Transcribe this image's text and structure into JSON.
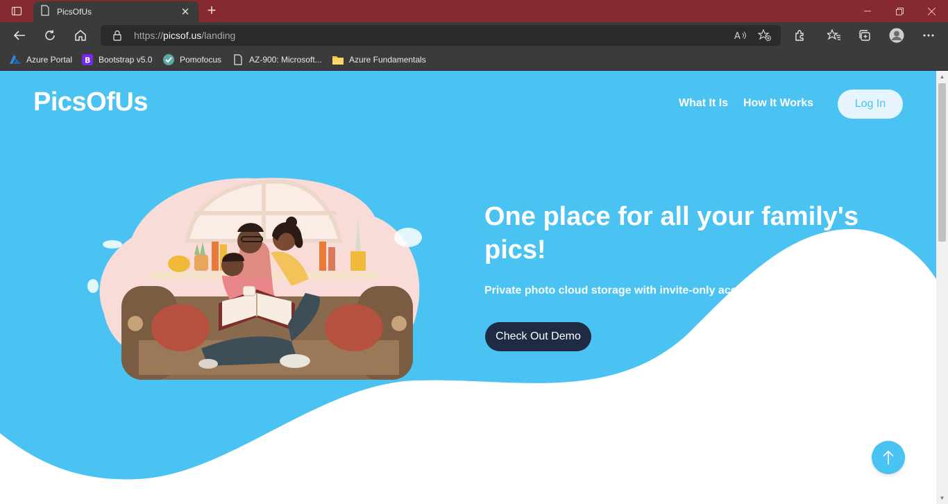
{
  "browser": {
    "tab_title": "PicsOfUs",
    "url_prefix": "https://",
    "url_host": "picsof.us",
    "url_path": "/landing",
    "bookmarks": [
      {
        "label": "Azure Portal",
        "icon": "azure-icon"
      },
      {
        "label": "Bootstrap v5.0",
        "icon": "bootstrap-icon"
      },
      {
        "label": "Pomofocus",
        "icon": "pomofocus-check-icon"
      },
      {
        "label": "AZ-900: Microsoft...",
        "icon": "page-icon"
      },
      {
        "label": "Azure Fundamentals",
        "icon": "folder-icon"
      }
    ],
    "colors": {
      "titlebar": "#852a2e",
      "toolbar": "#3b3b3b"
    }
  },
  "page": {
    "logo": "PicsOfUs",
    "nav": [
      "What It Is",
      "How It Works"
    ],
    "login_label": "Log In",
    "hero_title": "One place for all your family's pics!",
    "hero_subtitle": "Private photo cloud storage with invite-only access",
    "cta_label": "Check Out Demo",
    "colors": {
      "brand_blue": "#4ac3f2",
      "cta_dark": "#1f2a44"
    }
  }
}
